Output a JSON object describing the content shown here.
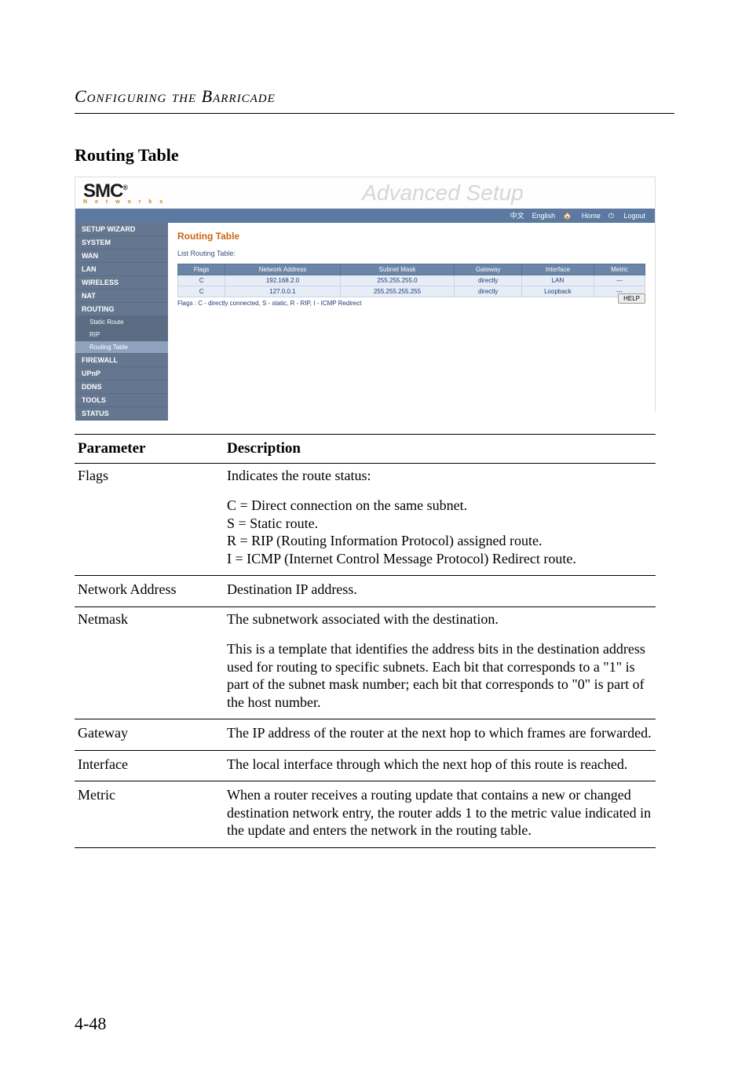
{
  "page": {
    "header": "Configuring the Barricade",
    "section_title": "Routing Table",
    "page_number": "4-48"
  },
  "screenshot": {
    "logo": {
      "main": "SMC",
      "reg": "®",
      "sub": "N e t w o r k s"
    },
    "adv": "Advanced Setup",
    "langbar": {
      "chinese": "中文",
      "english": "English",
      "home": "Home",
      "logout": "Logout"
    },
    "sidebar": [
      "SETUP WIZARD",
      "SYSTEM",
      "WAN",
      "LAN",
      "WIRELESS",
      "NAT",
      "ROUTING",
      "Static Route",
      "RIP",
      "Routing Table",
      "FIREWALL",
      "UPnP",
      "DDNS",
      "TOOLS",
      "STATUS"
    ],
    "main": {
      "title": "Routing Table",
      "subtitle": "List Routing Table:",
      "headers": [
        "Flags",
        "Network Address",
        "Subnet Mask",
        "Gateway",
        "Interface",
        "Metric"
      ],
      "rows": [
        [
          "C",
          "192.168.2.0",
          "255.255.255.0",
          "directly",
          "LAN",
          "---"
        ],
        [
          "C",
          "127.0.0.1",
          "255.255.255.255",
          "directly",
          "Loopback",
          "---"
        ]
      ],
      "flags_line": "Flags :   C - directly connected, S - static, R - RIP, I - ICMP Redirect",
      "help": "HELP"
    }
  },
  "desc": {
    "headers": {
      "param": "Parameter",
      "desc": "Description"
    },
    "rows": [
      {
        "param": "Flags",
        "top": "Indicates the route status:",
        "sub": "C = Direct connection on the same subnet.\nS = Static route.\nR = RIP (Routing Information Protocol) assigned route.\nI = ICMP (Internet Control Message Protocol) Redirect route."
      },
      {
        "param": "Network Address",
        "top": "Destination IP address."
      },
      {
        "param": "Netmask",
        "top": "The subnetwork associated with the destination.",
        "sub": "This is a template that identifies the address bits in the destination address used for routing to specific subnets. Each bit that corresponds to a \"1\" is part of the subnet mask number; each bit that corresponds to \"0\" is part of the host number."
      },
      {
        "param": "Gateway",
        "top": "The IP address of the router at the next hop to which frames are forwarded."
      },
      {
        "param": "Interface",
        "top": "The local interface through which the next hop of this route is reached."
      },
      {
        "param": "Metric",
        "top": "When a router receives a routing update that contains a new or changed destination network entry, the router adds 1 to the metric value indicated in the update and enters the network in the routing table."
      }
    ]
  }
}
